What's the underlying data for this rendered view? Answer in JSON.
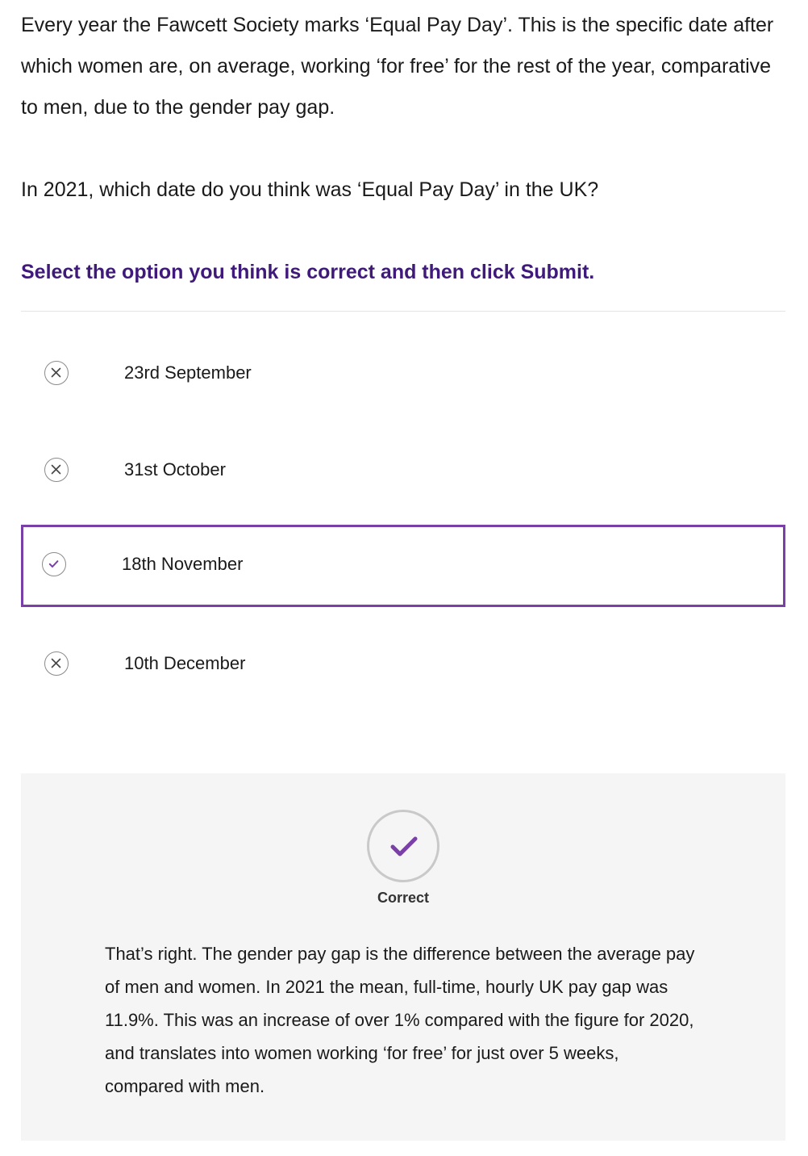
{
  "intro": "Every year the Fawcett Society marks ‘Equal Pay Day’. This is the specific date after which women are, on average, working ‘for free’ for the rest of the year, comparative to men, due to the gender pay gap.",
  "question": "In 2021, which date do you think was ‘Equal Pay Day’ in the UK?",
  "instruction": "Select the option you think is correct and then click Submit.",
  "options": [
    {
      "label": "23rd September",
      "state": "incorrect",
      "icon": "cross-icon"
    },
    {
      "label": "31st October",
      "state": "incorrect",
      "icon": "cross-icon"
    },
    {
      "label": "18th November",
      "state": "correct",
      "selected": true,
      "icon": "check-icon"
    },
    {
      "label": "10th December",
      "state": "incorrect",
      "icon": "cross-icon"
    }
  ],
  "feedback": {
    "status": "Correct",
    "icon": "check-icon",
    "explanation": "That’s right. The gender pay gap is the difference between the average pay of men and women. In 2021 the mean, full-time, hourly UK pay gap was 11.9%. This was an increase of over 1% compared with the figure for 2020, and translates into women working ‘for free’ for just over 5 weeks, compared with men."
  },
  "colors": {
    "accent": "#7b3fa8",
    "instruction": "#3f1a7a",
    "feedback_bg": "#f5f5f5",
    "icon_grey": "#8a8a8a"
  }
}
